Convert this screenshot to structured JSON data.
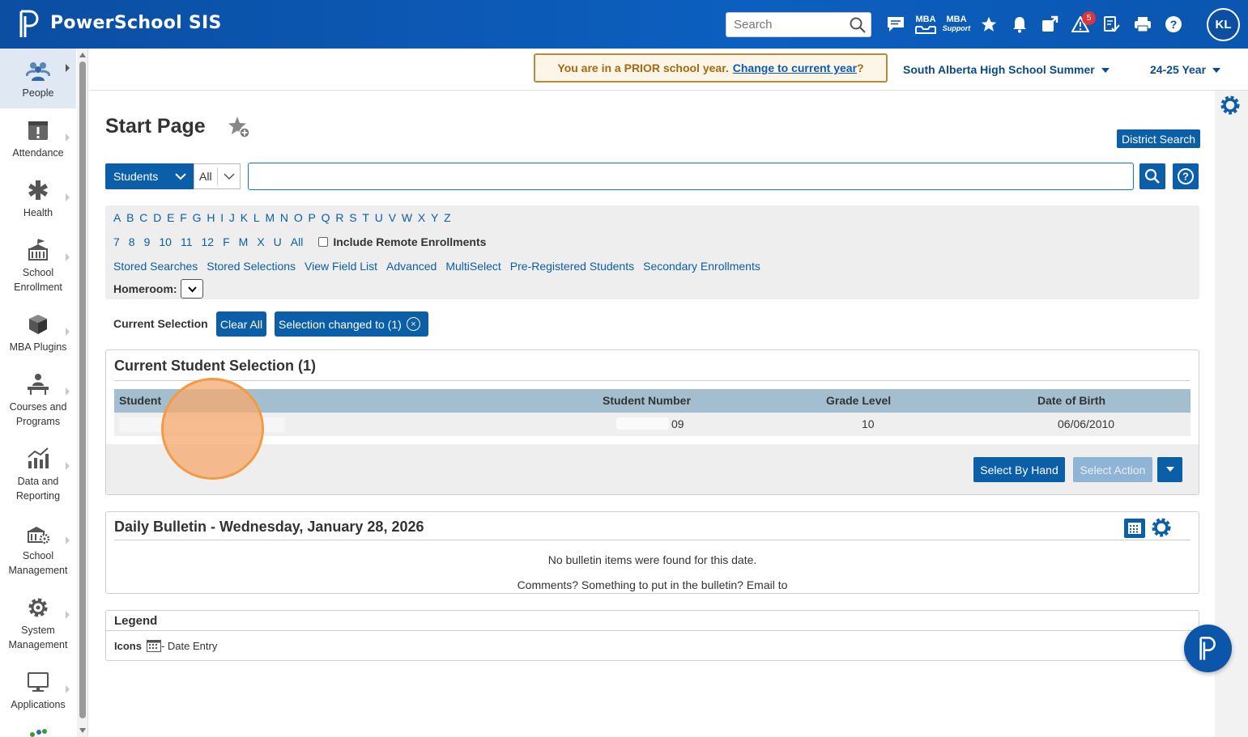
{
  "app": {
    "brand": "PowerSchool SIS",
    "search_placeholder": "Search",
    "avatar_initials": "KL",
    "alert_count": "5"
  },
  "topicons": {
    "mba": "MBA",
    "mba_support_top": "MBA",
    "mba_support_bottom": "Support"
  },
  "nav": [
    {
      "label": "People"
    },
    {
      "label": "Attendance"
    },
    {
      "label": "Health"
    },
    {
      "label": "School Enrollment"
    },
    {
      "label": "MBA Plugins"
    },
    {
      "label": "Courses and Programs"
    },
    {
      "label": "Data and Reporting"
    },
    {
      "label": "School Management"
    },
    {
      "label": "System Management"
    },
    {
      "label": "Applications"
    }
  ],
  "subheader": {
    "prior_text": "You are in a PRIOR school year.",
    "prior_link": "Change to current year",
    "prior_q": "?",
    "school": "South Alberta High School Summer",
    "year": "24-25 Year"
  },
  "main": {
    "title": "Start Page",
    "district_search": "District Search",
    "students_dd": "Students",
    "all_dd": "All"
  },
  "filters": {
    "letters": [
      "A",
      "B",
      "C",
      "D",
      "E",
      "F",
      "G",
      "H",
      "I",
      "J",
      "K",
      "L",
      "M",
      "N",
      "O",
      "P",
      "Q",
      "R",
      "S",
      "T",
      "U",
      "V",
      "W",
      "X",
      "Y",
      "Z"
    ],
    "grades": [
      "7",
      "8",
      "9",
      "10",
      "11",
      "12",
      "F",
      "M",
      "X",
      "U",
      "All"
    ],
    "include_remote": "Include Remote Enrollments",
    "links": [
      "Stored Searches",
      "Stored Selections",
      "View Field List",
      "Advanced",
      "MultiSelect",
      "Pre-Registered Students",
      "Secondary Enrollments"
    ],
    "homeroom": "Homeroom:"
  },
  "selection": {
    "label": "Current Selection",
    "clear": "Clear All",
    "changed": "Selection changed to (1)",
    "x": "×"
  },
  "student_box": {
    "title": "Current Student Selection (1)",
    "headers": {
      "student": "Student",
      "number": "Student Number",
      "grade": "Grade Level",
      "dob": "Date of Birth"
    },
    "row": {
      "number": "09",
      "grade": "10",
      "dob": "06/06/2010"
    },
    "select_by_hand": "Select By Hand",
    "select_action": "Select Action"
  },
  "bulletin": {
    "title": "Daily Bulletin - Wednesday, January 28, 2026",
    "none": "No bulletin items were found for this date.",
    "comments": "Comments? Something to put in the bulletin? Email to"
  },
  "legend": {
    "title": "Legend",
    "icons": "Icons",
    "date_entry": "- Date Entry"
  },
  "colors": {
    "brand_blue": "#0b5ea8",
    "topbar": "#0b4ea2",
    "prior_border": "#b58b3c",
    "table_header": "#a3bfcf"
  }
}
